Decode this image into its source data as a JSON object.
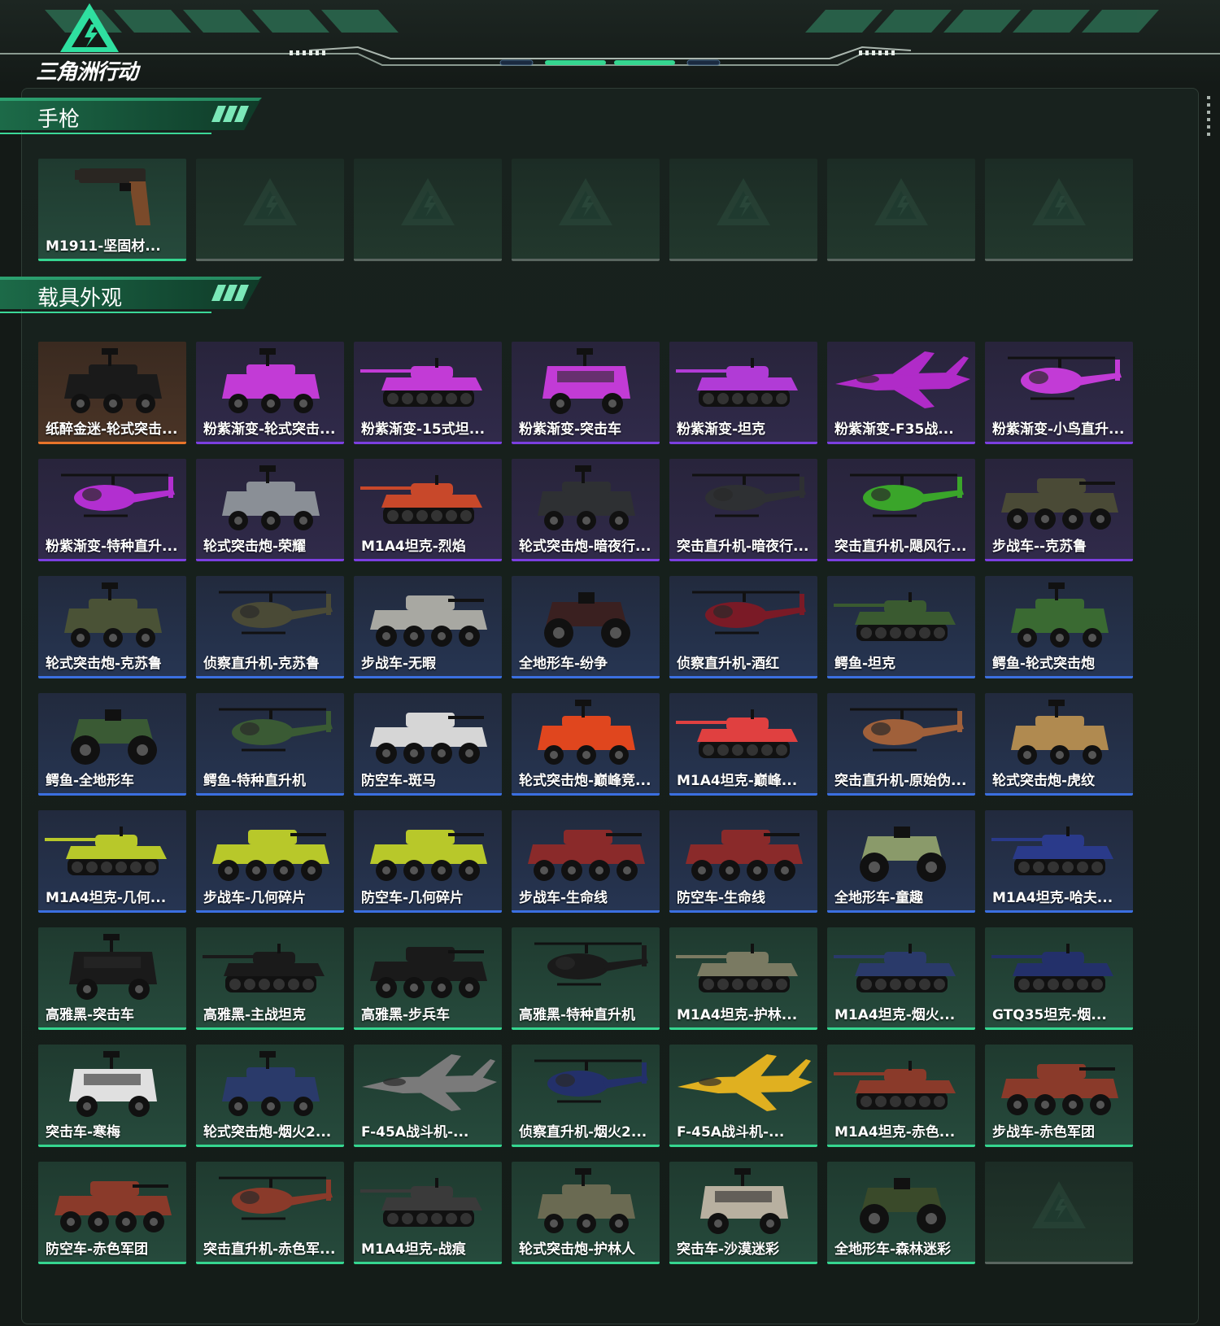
{
  "brand": {
    "name": "三角洲行动",
    "logo": "triangle-logo"
  },
  "sections": [
    {
      "title": "手枪",
      "items": [
        {
          "label": "M1911-坚固材...",
          "rarity": "green",
          "kind": "pistol",
          "color": "#2a2622"
        },
        {
          "label": "",
          "rarity": "empty",
          "kind": "empty",
          "color": ""
        },
        {
          "label": "",
          "rarity": "empty",
          "kind": "empty",
          "color": ""
        },
        {
          "label": "",
          "rarity": "empty",
          "kind": "empty",
          "color": ""
        },
        {
          "label": "",
          "rarity": "empty",
          "kind": "empty",
          "color": ""
        },
        {
          "label": "",
          "rarity": "empty",
          "kind": "empty",
          "color": ""
        },
        {
          "label": "",
          "rarity": "empty",
          "kind": "empty",
          "color": ""
        }
      ]
    },
    {
      "title": "载具外观",
      "items": [
        {
          "label": "纸醉金迷-轮式突击...",
          "rarity": "orange",
          "kind": "wheeled",
          "color": "#1a1a1a"
        },
        {
          "label": "粉紫渐变-轮式突击...",
          "rarity": "purple",
          "kind": "wheeled",
          "color": "#c23bd6"
        },
        {
          "label": "粉紫渐变-15式坦...",
          "rarity": "purple",
          "kind": "tank",
          "color": "#c23bd6"
        },
        {
          "label": "粉紫渐变-突击车",
          "rarity": "purple",
          "kind": "car",
          "color": "#c23bd6"
        },
        {
          "label": "粉紫渐变-坦克",
          "rarity": "purple",
          "kind": "tank",
          "color": "#b13bd6"
        },
        {
          "label": "粉紫渐变-F35战...",
          "rarity": "purple",
          "kind": "jet",
          "color": "#b02bc8"
        },
        {
          "label": "粉紫渐变-小鸟直升...",
          "rarity": "purple",
          "kind": "heli",
          "color": "#c23bd6"
        },
        {
          "label": "粉紫渐变-特种直升...",
          "rarity": "purple",
          "kind": "heli",
          "color": "#b22fd0"
        },
        {
          "label": "轮式突击炮-荣耀",
          "rarity": "purple",
          "kind": "wheeled",
          "color": "#8a8f96"
        },
        {
          "label": "M1A4坦克-烈焰",
          "rarity": "purple",
          "kind": "tank",
          "color": "#c8482a"
        },
        {
          "label": "轮式突击炮-暗夜行...",
          "rarity": "purple",
          "kind": "wheeled",
          "color": "#2e3033"
        },
        {
          "label": "突击直升机-暗夜行...",
          "rarity": "purple",
          "kind": "heli",
          "color": "#2e3033"
        },
        {
          "label": "突击直升机-飓风行...",
          "rarity": "purple",
          "kind": "heli",
          "color": "#3aa52a"
        },
        {
          "label": "步战车--克苏鲁",
          "rarity": "purple",
          "kind": "apc",
          "color": "#4a4a36"
        },
        {
          "label": "轮式突击炮-克苏鲁",
          "rarity": "blue",
          "kind": "wheeled",
          "color": "#4a5236"
        },
        {
          "label": "侦察直升机-克苏鲁",
          "rarity": "blue",
          "kind": "heli",
          "color": "#4a4a36"
        },
        {
          "label": "步战车-无暇",
          "rarity": "blue",
          "kind": "apc",
          "color": "#a8a8a2"
        },
        {
          "label": "全地形车-纷争",
          "rarity": "blue",
          "kind": "atv",
          "color": "#3a2020"
        },
        {
          "label": "侦察直升机-酒红",
          "rarity": "blue",
          "kind": "heli",
          "color": "#7a1a26"
        },
        {
          "label": "鳄鱼-坦克",
          "rarity": "blue",
          "kind": "tank",
          "color": "#3a5a30"
        },
        {
          "label": "鳄鱼-轮式突击炮",
          "rarity": "blue",
          "kind": "wheeled",
          "color": "#3a6a32"
        },
        {
          "label": "鳄鱼-全地形车",
          "rarity": "blue",
          "kind": "atv",
          "color": "#3a5a34"
        },
        {
          "label": "鳄鱼-特种直升机",
          "rarity": "blue",
          "kind": "heli",
          "color": "#3a5a34"
        },
        {
          "label": "防空车-斑马",
          "rarity": "blue",
          "kind": "apc",
          "color": "#d6d6d6"
        },
        {
          "label": "轮式突击炮-巅峰竞...",
          "rarity": "blue",
          "kind": "wheeled",
          "color": "#e0461e"
        },
        {
          "label": "M1A4坦克-巅峰...",
          "rarity": "blue",
          "kind": "tank",
          "color": "#e04040"
        },
        {
          "label": "突击直升机-原始伪...",
          "rarity": "blue",
          "kind": "heli",
          "color": "#a0603a"
        },
        {
          "label": "轮式突击炮-虎纹",
          "rarity": "blue",
          "kind": "wheeled",
          "color": "#b08a50"
        },
        {
          "label": "M1A4坦克-几何...",
          "rarity": "blue",
          "kind": "tank",
          "color": "#b8c82a"
        },
        {
          "label": "步战车-几何碎片",
          "rarity": "blue",
          "kind": "apc",
          "color": "#b8c82a"
        },
        {
          "label": "防空车-几何碎片",
          "rarity": "blue",
          "kind": "apc",
          "color": "#b8c82a"
        },
        {
          "label": "步战车-生命线",
          "rarity": "blue",
          "kind": "apc",
          "color": "#8a2a2a"
        },
        {
          "label": "防空车-生命线",
          "rarity": "blue",
          "kind": "apc",
          "color": "#8a2a2a"
        },
        {
          "label": "全地形车-童趣",
          "rarity": "blue",
          "kind": "atv",
          "color": "#8a9a6a"
        },
        {
          "label": "M1A4坦克-哈夫...",
          "rarity": "blue",
          "kind": "tank",
          "color": "#2a3a8a"
        },
        {
          "label": "高雅黑-突击车",
          "rarity": "green",
          "kind": "car",
          "color": "#1a1a1a"
        },
        {
          "label": "高雅黑-主战坦克",
          "rarity": "green",
          "kind": "tank",
          "color": "#1a1a1a"
        },
        {
          "label": "高雅黑-步兵车",
          "rarity": "green",
          "kind": "apc",
          "color": "#1a1a1a"
        },
        {
          "label": "高雅黑-特种直升机",
          "rarity": "green",
          "kind": "heli",
          "color": "#1a1a1a"
        },
        {
          "label": "M1A4坦克-护林...",
          "rarity": "green",
          "kind": "tank",
          "color": "#7a7a62"
        },
        {
          "label": "M1A4坦克-烟火...",
          "rarity": "green",
          "kind": "tank",
          "color": "#2a3a6a"
        },
        {
          "label": "GTQ35坦克-烟...",
          "rarity": "green",
          "kind": "tank",
          "color": "#23306a"
        },
        {
          "label": "突击车-寒梅",
          "rarity": "green",
          "kind": "car",
          "color": "#e0e0e0"
        },
        {
          "label": "轮式突击炮-烟火2...",
          "rarity": "green",
          "kind": "wheeled",
          "color": "#2a3a6a"
        },
        {
          "label": "F-45A战斗机-...",
          "rarity": "green",
          "kind": "jet",
          "color": "#7a7a7a"
        },
        {
          "label": "侦察直升机-烟火2...",
          "rarity": "green",
          "kind": "heli",
          "color": "#23306a"
        },
        {
          "label": "F-45A战斗机-...",
          "rarity": "green",
          "kind": "jet",
          "color": "#e0b020"
        },
        {
          "label": "M1A4坦克-赤色...",
          "rarity": "green",
          "kind": "tank",
          "color": "#8a3a2a"
        },
        {
          "label": "步战车-赤色军团",
          "rarity": "green",
          "kind": "apc",
          "color": "#8a3a2a"
        },
        {
          "label": "防空车-赤色军团",
          "rarity": "green",
          "kind": "apc",
          "color": "#8a3a2a"
        },
        {
          "label": "突击直升机-赤色军...",
          "rarity": "green",
          "kind": "heli",
          "color": "#8a3a2a"
        },
        {
          "label": "M1A4坦克-战痕",
          "rarity": "green",
          "kind": "tank",
          "color": "#3a3a3a"
        },
        {
          "label": "轮式突击炮-护林人",
          "rarity": "green",
          "kind": "wheeled",
          "color": "#6a6a52"
        },
        {
          "label": "突击车-沙漠迷彩",
          "rarity": "green",
          "kind": "car",
          "color": "#b8b0a0"
        },
        {
          "label": "全地形车-森林迷彩",
          "rarity": "green",
          "kind": "atv",
          "color": "#3a4a2a"
        },
        {
          "label": "",
          "rarity": "empty",
          "kind": "empty",
          "color": ""
        }
      ]
    }
  ]
}
